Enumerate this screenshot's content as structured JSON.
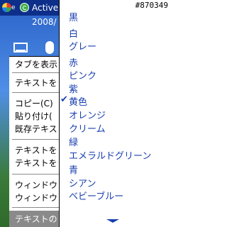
{
  "title_bar": {
    "app_title": "Active",
    "fragment": "e"
  },
  "today": {
    "date_fragment": "2008/"
  },
  "context_menu": {
    "items": [
      "タブを表示",
      "テキストを",
      "コピー(C)",
      "貼り付け(",
      "既存テキス",
      "テキストを",
      "テキストを",
      "ウィンドウ",
      "ウィンドウ",
      "テキストの"
    ]
  },
  "color_menu": {
    "color_code": "#870349",
    "selected": "黄色",
    "items": [
      "黒",
      "白",
      "グレー",
      "赤",
      "ピンク",
      "紫",
      "黄色",
      "オレンジ",
      "クリーム",
      "緑",
      "エメラルドグリーン",
      "青",
      "シアン",
      "ベビーブルー"
    ]
  },
  "colors": {
    "menu_text": "#1a3fb0",
    "title_bar": "#0d2f8a",
    "highlight": "#8a8a8a"
  }
}
